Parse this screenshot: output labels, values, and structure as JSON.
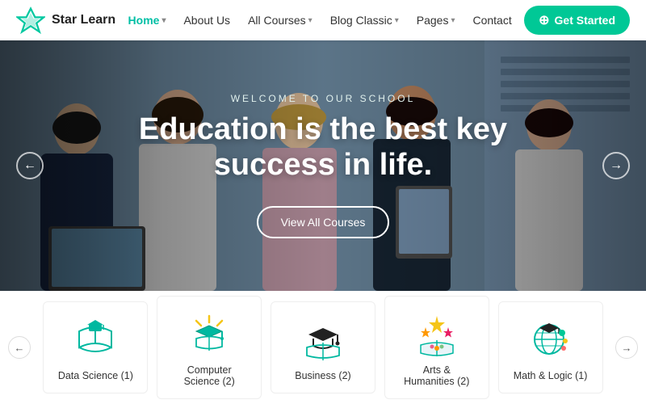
{
  "logo": {
    "text": "Star Learn"
  },
  "nav": {
    "items": [
      {
        "label": "Home",
        "active": true,
        "hasDropdown": true
      },
      {
        "label": "About Us",
        "active": false,
        "hasDropdown": false
      },
      {
        "label": "All Courses",
        "active": false,
        "hasDropdown": true
      },
      {
        "label": "Blog Classic",
        "active": false,
        "hasDropdown": true
      },
      {
        "label": "Pages",
        "active": false,
        "hasDropdown": true
      },
      {
        "label": "Contact",
        "active": false,
        "hasDropdown": false
      }
    ],
    "cta": "Get Started"
  },
  "hero": {
    "subtitle": "Welcome to our school",
    "title_line1": "Education is the best key",
    "title_line2": "success in life.",
    "cta": "View All Courses"
  },
  "categories": {
    "items": [
      {
        "label": "Data Science (1)",
        "icon": "data-science"
      },
      {
        "label": "Computer Science (2)",
        "icon": "computer-science"
      },
      {
        "label": "Business (2)",
        "icon": "business"
      },
      {
        "label": "Arts & Humanities (2)",
        "icon": "arts"
      },
      {
        "label": "Math & Logic (1)",
        "icon": "math"
      }
    ]
  }
}
